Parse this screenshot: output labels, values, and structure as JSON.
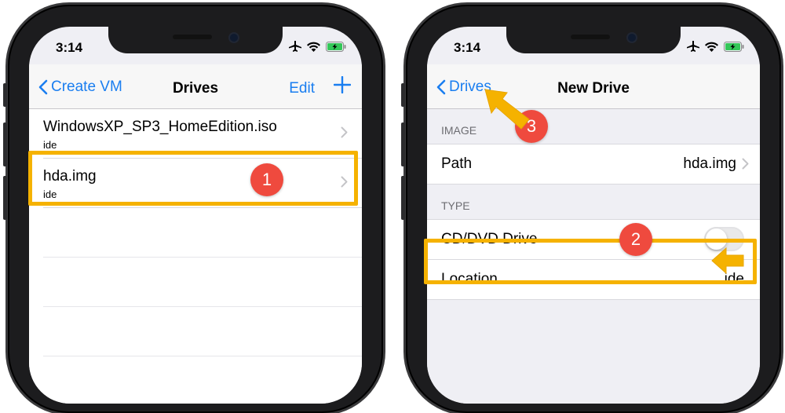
{
  "colors": {
    "ios_blue": "#1a7ef0",
    "annotation_orange": "#f5b200",
    "badge_red": "#ef4a3e"
  },
  "left_phone": {
    "status": {
      "time": "3:14"
    },
    "nav": {
      "back_label": "Create VM",
      "title": "Drives",
      "edit_label": "Edit",
      "add_icon": "plus-icon"
    },
    "drives": [
      {
        "name": "WindowsXP_SP3_HomeEdition.iso",
        "interface": "ide"
      },
      {
        "name": "hda.img",
        "interface": "ide"
      }
    ]
  },
  "right_phone": {
    "status": {
      "time": "3:14"
    },
    "nav": {
      "back_label": "Drives",
      "title": "New Drive"
    },
    "sections": {
      "image": {
        "header": "IMAGE",
        "path_label": "Path",
        "path_value": "hda.img"
      },
      "type": {
        "header": "TYPE",
        "cd_label": "CD/DVD Drive",
        "cd_enabled": false,
        "location_label": "Location",
        "location_value": "ide"
      }
    }
  },
  "annotations": {
    "step1": "1",
    "step2": "2",
    "step3": "3"
  }
}
